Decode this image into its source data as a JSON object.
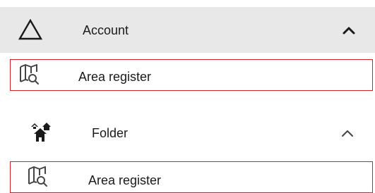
{
  "sections": [
    {
      "label": "Account",
      "icon": "triangle-outline-icon",
      "expanded": true,
      "items": [
        {
          "label": "Area register",
          "icon": "map-search-icon",
          "highlighted": true
        }
      ]
    },
    {
      "label": "Folder",
      "icon": "houses-icon",
      "expanded": true,
      "items": [
        {
          "label": "Area register",
          "icon": "map-search-icon",
          "highlighted": true
        }
      ]
    }
  ],
  "colors": {
    "header_bg": "#e8e8e8",
    "highlight_border": "#d9202a",
    "text": "#1a1a1a"
  }
}
